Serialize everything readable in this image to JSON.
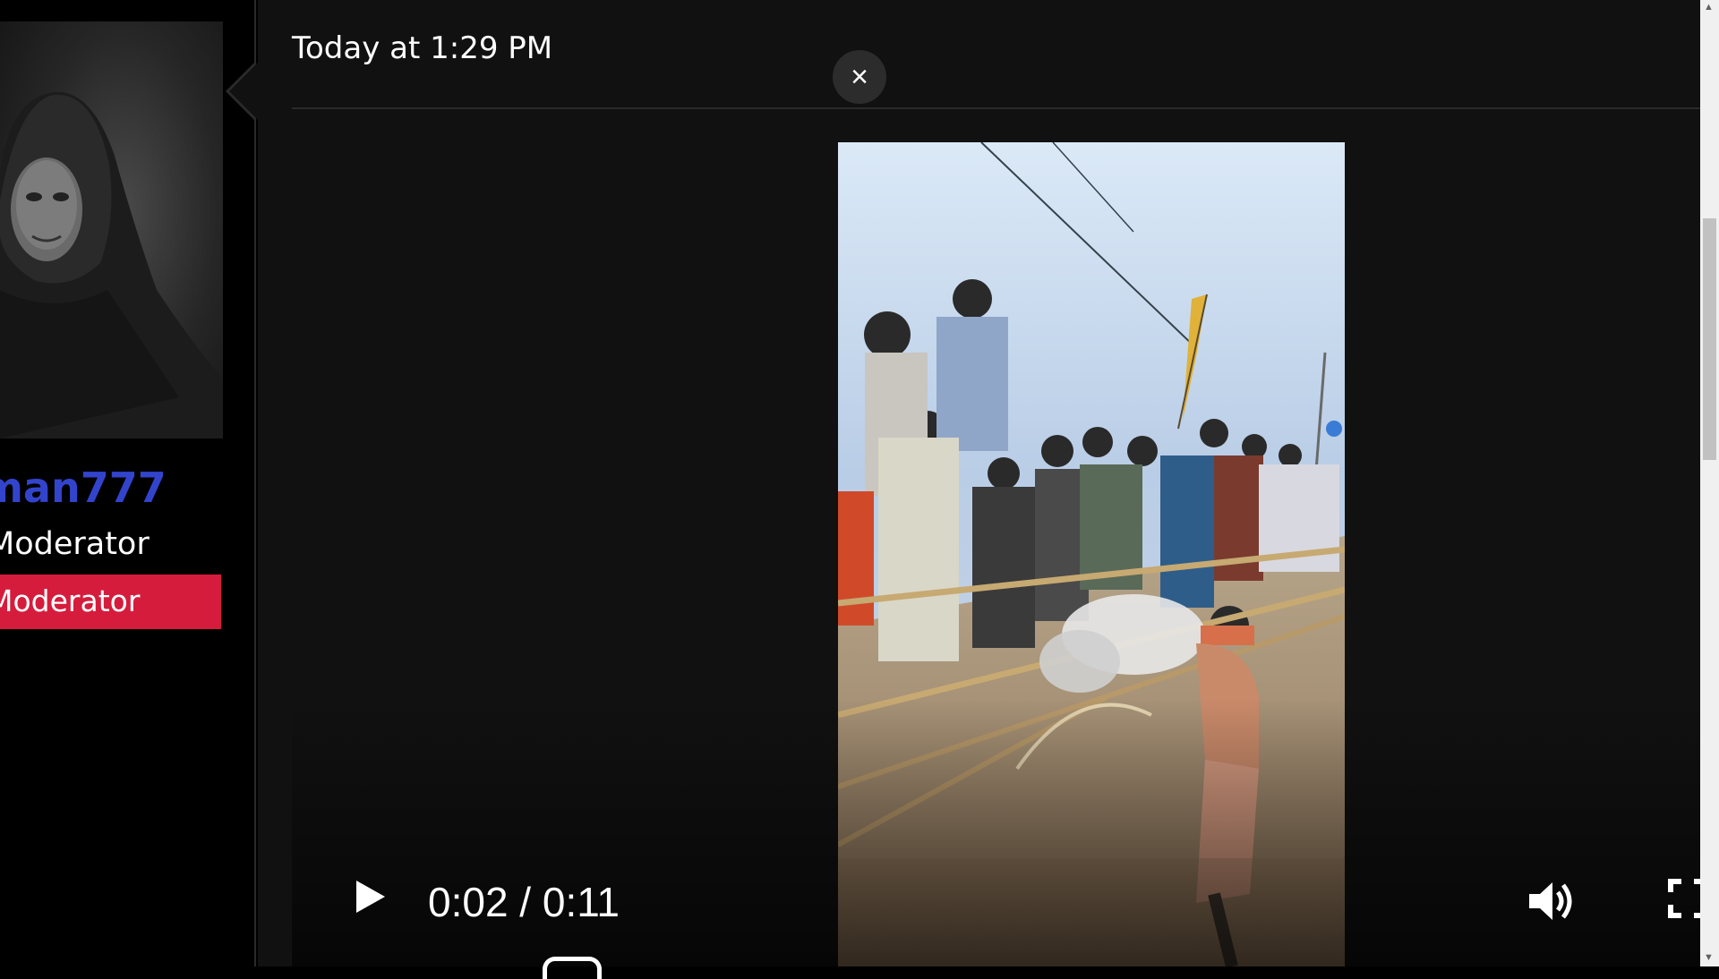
{
  "profile": {
    "username": "man777",
    "role_text": "Moderator",
    "role_badge": "Moderator",
    "badge_color": "#d61c3c",
    "username_color": "#3344cc"
  },
  "message": {
    "timestamp": "Today at 1:29 PM"
  },
  "lightbox": {
    "close_icon": "×"
  },
  "video": {
    "current_time": "0:02",
    "duration": "0:11",
    "time_display": "0:02 / 0:11",
    "progress": 0.18,
    "controls": {
      "play_icon": "play-icon",
      "volume_icon": "volume-icon",
      "fullscreen_icon": "fullscreen-icon"
    }
  },
  "scrollbar": {
    "up_arrow": "▲",
    "down_arrow": "▼"
  }
}
